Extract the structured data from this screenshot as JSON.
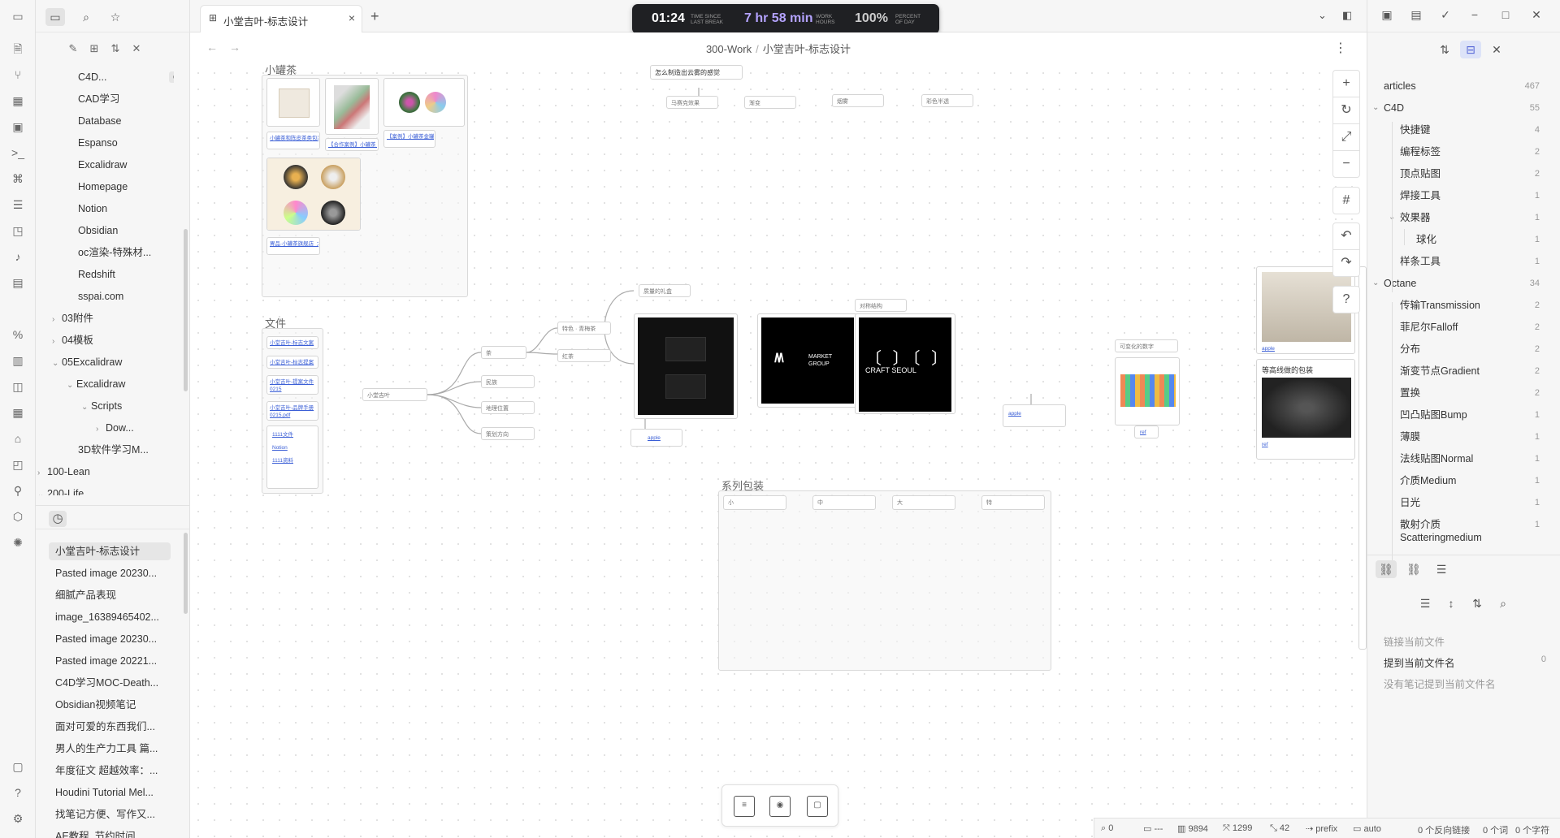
{
  "ribbon": {
    "icons": [
      "sidebar-toggle-icon",
      "files-icon",
      "graph-icon",
      "blocks-icon",
      "calendar-icon",
      "terminal-icon",
      "command-icon",
      "template-icon",
      "canvas-icon",
      "microphone-icon",
      "table-icon",
      "percent-code-icon",
      "chart-icon",
      "dashboard-icon",
      "kanban-icon",
      "home-icon",
      "diagram-icon",
      "pin-icon",
      "cube-icon",
      "bulb-icon"
    ],
    "bottom_icons": [
      "vault-icon",
      "help-icon",
      "settings-icon"
    ]
  },
  "file_tree": [
    {
      "label": "C4D...",
      "indent": 2,
      "badge": "CANVAS"
    },
    {
      "label": "CAD学习",
      "indent": 2
    },
    {
      "label": "Database",
      "indent": 2
    },
    {
      "label": "Espanso",
      "indent": 2
    },
    {
      "label": "Excalidraw",
      "indent": 2
    },
    {
      "label": "Homepage",
      "indent": 2
    },
    {
      "label": "Notion",
      "indent": 2
    },
    {
      "label": "Obsidian",
      "indent": 2
    },
    {
      "label": "oc渲染-特殊材...",
      "indent": 2
    },
    {
      "label": "Redshift",
      "indent": 2
    },
    {
      "label": "sspai.com",
      "indent": 2
    },
    {
      "label": "03附件",
      "indent": 1,
      "chev": "›"
    },
    {
      "label": "04模板",
      "indent": 1,
      "chev": "›"
    },
    {
      "label": "05Excalidraw",
      "indent": 1,
      "chev": "⌄"
    },
    {
      "label": "Excalidraw",
      "indent": 2,
      "chev": "⌄"
    },
    {
      "label": "Scripts",
      "indent": 3,
      "chev": "⌄"
    },
    {
      "label": "Dow...",
      "indent": 4,
      "chev": "›"
    },
    {
      "label": "3D软件学习M...",
      "indent": 2
    },
    {
      "label": "100-Lean",
      "indent": 0,
      "chev": "›"
    },
    {
      "label": "200-Life",
      "indent": 0,
      "chev": "⌄"
    }
  ],
  "recent_files": [
    "小堂吉叶-标志设计",
    "Pasted image 20230...",
    "细腻产品表现",
    "image_16389465402...",
    "Pasted image 20230...",
    "Pasted image 20221...",
    "C4D学习MOC-Death...",
    "Obsidian视频笔记",
    "面对可爱的东西我们...",
    "男人的生产力工具 篇...",
    "年度征文 超越效率：...",
    "Houdini Tutorial Mel...",
    "找笔记方便、写作又...",
    "AE教程_节约时间..."
  ],
  "tab": {
    "title": "小堂吉叶-标志设计"
  },
  "timer": {
    "time_since_break": "01:24",
    "time_since_break_label": "TIME SINCE LAST BREAK",
    "work_hours": "7 hr 58 min",
    "work_hours_label": "WORK HOURS",
    "percent": "100%",
    "percent_label": "PERCENT OF DAY"
  },
  "breadcrumb": {
    "folder": "300-Work",
    "separator": "/",
    "file": "小堂吉叶-标志设计"
  },
  "canvas": {
    "group_xiaoguancha": "小罐茶",
    "group_files": "文件",
    "group_series": "系列包装",
    "question_node": "怎么制造出云雾的感觉",
    "question_children": [
      "马赛克效果",
      "渐变",
      "烟雾",
      "彩色半透"
    ],
    "tea_links": [
      "小罐茶和陈皮茶类包装茶叶礼盒设计",
      "【合作案例】小罐茶 · 茶叶设计方案",
      "【案例】小罐茶金罐系列包装设计",
      "胃品·小罐茶旗舰店_大益Bruit.com"
    ],
    "file_links": [
      "小堂吉叶-标志文案",
      "小堂吉叶-标志提案",
      "小堂吉叶-提案文件 0215",
      "小堂吉叶-品牌手册 0215.pdf",
      "1111文件",
      "Notion",
      "1111资料"
    ],
    "mindmap_root": "小堂吉叶",
    "mindmap_branches": [
      "茶",
      "民族",
      "地理位置",
      "策划方向"
    ],
    "mindmap_leaves": [
      "特色 · 青梅茶",
      "红茶"
    ],
    "node_texture": "质量的礼盒",
    "node_contrast": "对称结构",
    "node_digits": "可变化的数字",
    "node_lines": "等高线做的包装",
    "link_apple": "apple",
    "link_ref": "ref",
    "market_group": "MARKET GROUP",
    "craft_seoul": "CRAFT SEOUL",
    "series_boxes": [
      "小",
      "中",
      "大",
      "特"
    ]
  },
  "canvas_controls": [
    "zoom-in-icon",
    "reset-icon",
    "fullscreen-icon",
    "zoom-out-icon",
    "grid-icon",
    "undo-icon",
    "redo-icon",
    "help-icon"
  ],
  "status_bar": {
    "links": "0",
    "words_sep": "---",
    "words": "9894",
    "chars": "1299",
    "count": "42",
    "prefix": "prefix",
    "auto": "auto",
    "backlinks": "0 个反向链接",
    "words2": "0 个词",
    "chars2": "0 个字符"
  },
  "tag_pane": {
    "rows": [
      {
        "name": "articles",
        "count": "467",
        "level": 0
      },
      {
        "name": "C4D",
        "count": "55",
        "level": 0,
        "chev": "⌄"
      },
      {
        "name": "快捷键",
        "count": "4",
        "level": 1
      },
      {
        "name": "编程标签",
        "count": "2",
        "level": 1
      },
      {
        "name": "顶点贴图",
        "count": "2",
        "level": 1
      },
      {
        "name": "焊接工具",
        "count": "1",
        "level": 1
      },
      {
        "name": "效果器",
        "count": "1",
        "level": 1,
        "chev": "⌄"
      },
      {
        "name": "球化",
        "count": "1",
        "level": 2
      },
      {
        "name": "样条工具",
        "count": "1",
        "level": 1
      },
      {
        "name": "Octane",
        "count": "34",
        "level": 0,
        "chev": "⌄"
      },
      {
        "name": "传输Transmission",
        "count": "2",
        "level": 1
      },
      {
        "name": "菲尼尔Falloff",
        "count": "2",
        "level": 1
      },
      {
        "name": "分布",
        "count": "2",
        "level": 1
      },
      {
        "name": "渐变节点Gradient",
        "count": "2",
        "level": 1
      },
      {
        "name": "置换",
        "count": "2",
        "level": 1
      },
      {
        "name": "凹凸贴图Bump",
        "count": "1",
        "level": 1
      },
      {
        "name": "薄膜",
        "count": "1",
        "level": 1
      },
      {
        "name": "法线贴图Normal",
        "count": "1",
        "level": 1
      },
      {
        "name": "介质Medium",
        "count": "1",
        "level": 1
      },
      {
        "name": "日光",
        "count": "1",
        "level": 1
      },
      {
        "name": "散射介质",
        "name2": "Scatteringmedium",
        "count": "1",
        "level": 1
      }
    ]
  },
  "backlinks": {
    "linked_current": "链接当前文件",
    "mention_current": "提到当前文件名",
    "mention_count": "0",
    "no_notes": "没有笔记提到当前文件名"
  }
}
